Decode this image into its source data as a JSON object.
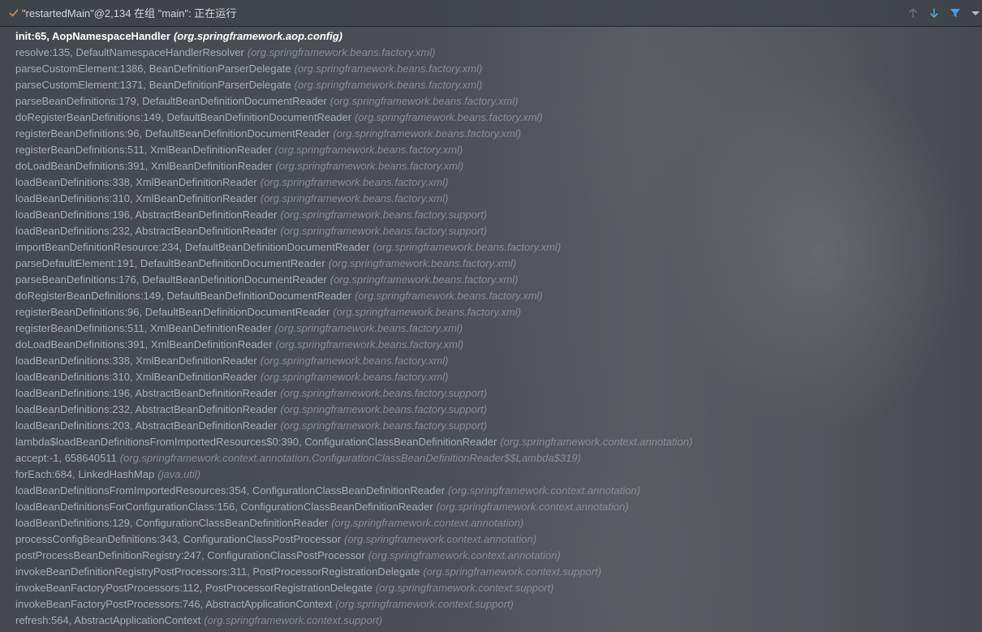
{
  "header": {
    "thread_title": "\"restartedMain\"@2,134 在组 \"main\": 正在运行",
    "icons": {
      "status": "check-icon",
      "up": "arrow-up-icon",
      "down": "arrow-down-icon",
      "filter": "filter-icon",
      "menu": "chevron-down-icon"
    },
    "colors": {
      "check": "#c8874f",
      "down_arrow": "#4aa8c9",
      "filter": "#4a9fe0",
      "up_arrow_disabled": "#6d7075"
    }
  },
  "frames": [
    {
      "method": "init:65, AopNamespaceHandler",
      "package": "(org.springframework.aop.config)"
    },
    {
      "method": "resolve:135, DefaultNamespaceHandlerResolver",
      "package": "(org.springframework.beans.factory.xml)"
    },
    {
      "method": "parseCustomElement:1386, BeanDefinitionParserDelegate",
      "package": "(org.springframework.beans.factory.xml)"
    },
    {
      "method": "parseCustomElement:1371, BeanDefinitionParserDelegate",
      "package": "(org.springframework.beans.factory.xml)"
    },
    {
      "method": "parseBeanDefinitions:179, DefaultBeanDefinitionDocumentReader",
      "package": "(org.springframework.beans.factory.xml)"
    },
    {
      "method": "doRegisterBeanDefinitions:149, DefaultBeanDefinitionDocumentReader",
      "package": "(org.springframework.beans.factory.xml)"
    },
    {
      "method": "registerBeanDefinitions:96, DefaultBeanDefinitionDocumentReader",
      "package": "(org.springframework.beans.factory.xml)"
    },
    {
      "method": "registerBeanDefinitions:511, XmlBeanDefinitionReader",
      "package": "(org.springframework.beans.factory.xml)"
    },
    {
      "method": "doLoadBeanDefinitions:391, XmlBeanDefinitionReader",
      "package": "(org.springframework.beans.factory.xml)"
    },
    {
      "method": "loadBeanDefinitions:338, XmlBeanDefinitionReader",
      "package": "(org.springframework.beans.factory.xml)"
    },
    {
      "method": "loadBeanDefinitions:310, XmlBeanDefinitionReader",
      "package": "(org.springframework.beans.factory.xml)"
    },
    {
      "method": "loadBeanDefinitions:196, AbstractBeanDefinitionReader",
      "package": "(org.springframework.beans.factory.support)"
    },
    {
      "method": "loadBeanDefinitions:232, AbstractBeanDefinitionReader",
      "package": "(org.springframework.beans.factory.support)"
    },
    {
      "method": "importBeanDefinitionResource:234, DefaultBeanDefinitionDocumentReader",
      "package": "(org.springframework.beans.factory.xml)"
    },
    {
      "method": "parseDefaultElement:191, DefaultBeanDefinitionDocumentReader",
      "package": "(org.springframework.beans.factory.xml)"
    },
    {
      "method": "parseBeanDefinitions:176, DefaultBeanDefinitionDocumentReader",
      "package": "(org.springframework.beans.factory.xml)"
    },
    {
      "method": "doRegisterBeanDefinitions:149, DefaultBeanDefinitionDocumentReader",
      "package": "(org.springframework.beans.factory.xml)"
    },
    {
      "method": "registerBeanDefinitions:96, DefaultBeanDefinitionDocumentReader",
      "package": "(org.springframework.beans.factory.xml)"
    },
    {
      "method": "registerBeanDefinitions:511, XmlBeanDefinitionReader",
      "package": "(org.springframework.beans.factory.xml)"
    },
    {
      "method": "doLoadBeanDefinitions:391, XmlBeanDefinitionReader",
      "package": "(org.springframework.beans.factory.xml)"
    },
    {
      "method": "loadBeanDefinitions:338, XmlBeanDefinitionReader",
      "package": "(org.springframework.beans.factory.xml)"
    },
    {
      "method": "loadBeanDefinitions:310, XmlBeanDefinitionReader",
      "package": "(org.springframework.beans.factory.xml)"
    },
    {
      "method": "loadBeanDefinitions:196, AbstractBeanDefinitionReader",
      "package": "(org.springframework.beans.factory.support)"
    },
    {
      "method": "loadBeanDefinitions:232, AbstractBeanDefinitionReader",
      "package": "(org.springframework.beans.factory.support)"
    },
    {
      "method": "loadBeanDefinitions:203, AbstractBeanDefinitionReader",
      "package": "(org.springframework.beans.factory.support)"
    },
    {
      "method": "lambda$loadBeanDefinitionsFromImportedResources$0:390, ConfigurationClassBeanDefinitionReader",
      "package": "(org.springframework.context.annotation)"
    },
    {
      "method": "accept:-1, 658640511",
      "package": "(org.springframework.context.annotation.ConfigurationClassBeanDefinitionReader$$Lambda$319)"
    },
    {
      "method": "forEach:684, LinkedHashMap",
      "package": "(java.util)"
    },
    {
      "method": "loadBeanDefinitionsFromImportedResources:354, ConfigurationClassBeanDefinitionReader",
      "package": "(org.springframework.context.annotation)"
    },
    {
      "method": "loadBeanDefinitionsForConfigurationClass:156, ConfigurationClassBeanDefinitionReader",
      "package": "(org.springframework.context.annotation)"
    },
    {
      "method": "loadBeanDefinitions:129, ConfigurationClassBeanDefinitionReader",
      "package": "(org.springframework.context.annotation)"
    },
    {
      "method": "processConfigBeanDefinitions:343, ConfigurationClassPostProcessor",
      "package": "(org.springframework.context.annotation)"
    },
    {
      "method": "postProcessBeanDefinitionRegistry:247, ConfigurationClassPostProcessor",
      "package": "(org.springframework.context.annotation)"
    },
    {
      "method": "invokeBeanDefinitionRegistryPostProcessors:311, PostProcessorRegistrationDelegate",
      "package": "(org.springframework.context.support)"
    },
    {
      "method": "invokeBeanFactoryPostProcessors:112, PostProcessorRegistrationDelegate",
      "package": "(org.springframework.context.support)"
    },
    {
      "method": "invokeBeanFactoryPostProcessors:746, AbstractApplicationContext",
      "package": "(org.springframework.context.support)"
    },
    {
      "method": "refresh:564, AbstractApplicationContext",
      "package": "(org.springframework.context.support)"
    }
  ]
}
